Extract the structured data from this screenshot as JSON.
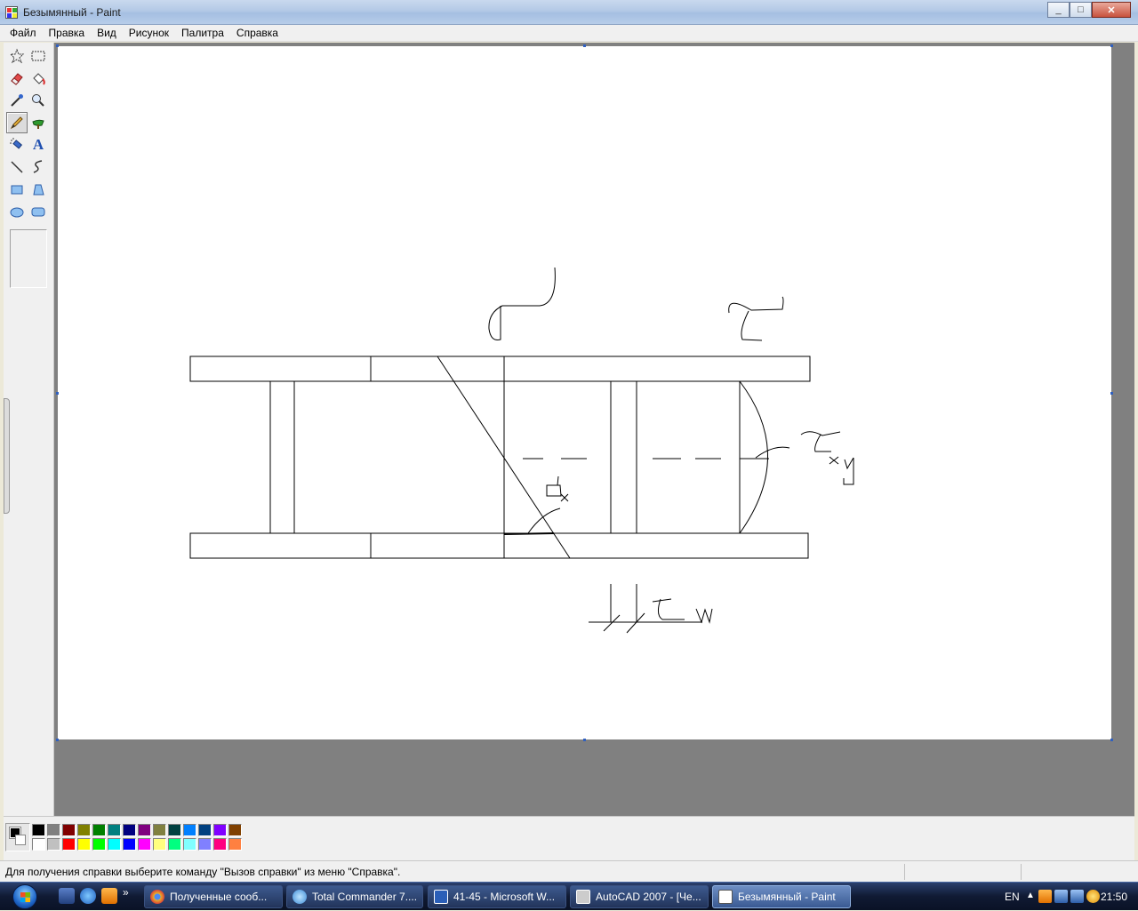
{
  "window": {
    "title": "Безымянный - Paint",
    "controls": {
      "minimize": "_",
      "maximize": "□",
      "close": "✕"
    }
  },
  "menu": [
    "Файл",
    "Правка",
    "Вид",
    "Рисунок",
    "Палитра",
    "Справка"
  ],
  "tools": [
    {
      "name": "free-select-tool",
      "icon": "star-select-icon"
    },
    {
      "name": "rect-select-tool",
      "icon": "rect-select-icon"
    },
    {
      "name": "eraser-tool",
      "icon": "eraser-icon"
    },
    {
      "name": "fill-tool",
      "icon": "paint-bucket-icon"
    },
    {
      "name": "pick-color-tool",
      "icon": "eyedropper-icon"
    },
    {
      "name": "magnifier-tool",
      "icon": "magnifier-icon"
    },
    {
      "name": "pencil-tool",
      "icon": "pencil-icon",
      "active": true
    },
    {
      "name": "brush-tool",
      "icon": "brush-icon"
    },
    {
      "name": "airbrush-tool",
      "icon": "airbrush-icon"
    },
    {
      "name": "text-tool",
      "icon": "text-icon",
      "label": "A"
    },
    {
      "name": "line-tool",
      "icon": "line-icon"
    },
    {
      "name": "curve-tool",
      "icon": "curve-icon"
    },
    {
      "name": "rectangle-tool",
      "icon": "rectangle-icon"
    },
    {
      "name": "polygon-tool",
      "icon": "polygon-icon"
    },
    {
      "name": "ellipse-tool",
      "icon": "ellipse-icon"
    },
    {
      "name": "rounded-rect-tool",
      "icon": "rounded-rect-icon"
    }
  ],
  "palette": {
    "foreground": "#000000",
    "background": "#ffffff",
    "colors": [
      "#000000",
      "#808080",
      "#800000",
      "#808000",
      "#008000",
      "#008080",
      "#000080",
      "#800080",
      "#808040",
      "#004040",
      "#0080ff",
      "#004080",
      "#8000ff",
      "#804000",
      "#ffffff",
      "#c0c0c0",
      "#ff0000",
      "#ffff00",
      "#00ff00",
      "#00ffff",
      "#0000ff",
      "#ff00ff",
      "#ffff80",
      "#00ff80",
      "#80ffff",
      "#8080ff",
      "#ff0080",
      "#ff8040"
    ]
  },
  "status": {
    "text": "Для получения справки выберите команду \"Вызов справки\" из меню \"Справка\"."
  },
  "taskbar": {
    "start": "start-button",
    "quicklaunch_more": "»",
    "tasks": [
      {
        "label": "Полученные сооб...",
        "icon": "chrome-icon",
        "color": "#e8b42a"
      },
      {
        "label": "Total Commander 7....",
        "icon": "total-commander-icon",
        "color": "#3d8bd6"
      },
      {
        "label": "41-45 - Microsoft W...",
        "icon": "word-icon",
        "color": "#2b5fb8"
      },
      {
        "label": "AutoCAD 2007 - [Че...",
        "icon": "autocad-icon",
        "color": "#cccccc"
      },
      {
        "label": "Безымянный - Paint",
        "icon": "paint-icon",
        "color": "#ffffff",
        "active": true
      }
    ],
    "lang": "EN",
    "clock": "21:50"
  }
}
